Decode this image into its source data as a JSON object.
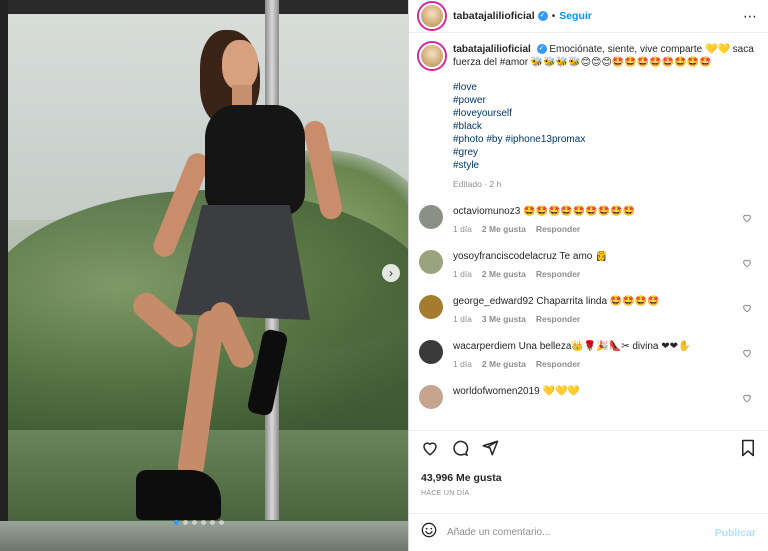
{
  "post": {
    "username": "tabatajalilioficial",
    "follow_label": "Seguir",
    "separator": "•",
    "more_icon": "more-icon"
  },
  "caption": {
    "username": "tabatajalilioficial",
    "text": "Emociónate, siente, vive comparte 💛💛 saca fuerza del #amor 🐝🐝🐝🐝😊😊😊🤩🤩🤩🤩🤩🤩🤩🤩",
    "hashtags": [
      "#love",
      "#power",
      "#loveyourself",
      "#black",
      "#photo #by #iphone13promax",
      "#grey",
      "#style"
    ],
    "edited": "Editado",
    "time": "2 h"
  },
  "comments": [
    {
      "user": "octaviomunoz3",
      "text": "🤩🤩🤩🤩🤩🤩🤩🤩🤩",
      "time": "1 día",
      "likes": "2 Me gusta",
      "reply": "Responder",
      "avatar_color": "#8a8f88"
    },
    {
      "user": "yosoyfranciscodelacruz",
      "text": "Te amo 👸",
      "time": "1 día",
      "likes": "2 Me gusta",
      "reply": "Responder",
      "avatar_color": "#9aa37e"
    },
    {
      "user": "george_edward92",
      "text": "Chaparrita linda 🤩🤩🤩🤩",
      "time": "1 día",
      "likes": "3 Me gusta",
      "reply": "Responder",
      "avatar_color": "#a47c2f"
    },
    {
      "user": "wacarperdiem",
      "text": "Una belleza👑🌹🎉👠✂ divina ❤❤✋",
      "time": "1 día",
      "likes": "2 Me gusta",
      "reply": "Responder",
      "avatar_color": "#3a3a3a"
    },
    {
      "user": "worldofwomen2019",
      "text": "💛💛💛",
      "time": "",
      "likes": "",
      "reply": "",
      "avatar_color": "#c7a48e"
    }
  ],
  "actions": {
    "like_icon": "heart-icon",
    "comment_icon": "comment-icon",
    "share_icon": "share-icon",
    "save_icon": "bookmark-icon"
  },
  "likes": "43,996 Me gusta",
  "time_ago": "HACE UN DÍA",
  "add_comment": {
    "placeholder": "Añade un comentario...",
    "post_label": "Publicar"
  },
  "carousel": {
    "dots": 6,
    "active": 0
  }
}
